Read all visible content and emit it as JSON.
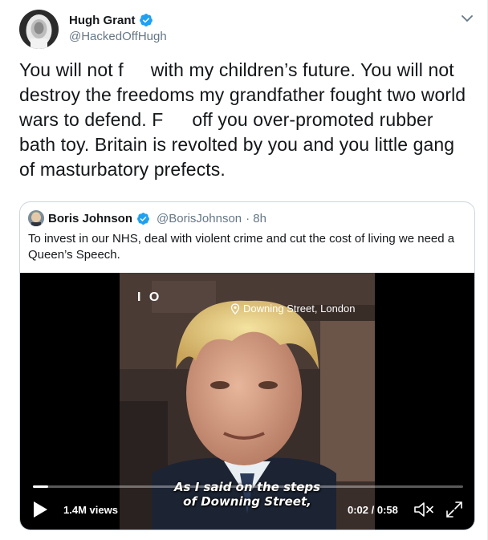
{
  "tweet": {
    "display_name": "Hugh Grant",
    "handle": "@HackedOffHugh",
    "text_line1_a": "You will not f",
    "text_line1_b": "with my children’s future. You will not",
    "text_line2": "destroy the freedoms my grandfather fought two world",
    "text_line3_a": "wars to defend. F",
    "text_line3_b": "off you over-promoted rubber",
    "text_line4": "bath toy. Britain is revolted by you and you little gang",
    "text_line5": "of masturbatory prefects.",
    "verified_color": "#1da1f2"
  },
  "quote": {
    "display_name": "Boris Johnson",
    "handle": "@BorisJohnson",
    "time": "· 8h",
    "text": "To invest in our NHS, deal with violent crime and cut the cost of living we need a Queen’s Speech.",
    "video": {
      "badge": "I O",
      "location": "Downing Street, London",
      "subtitle_line1": "As I said on the steps",
      "subtitle_line2": "of Downing Street,",
      "views": "1.4M views",
      "time": "0:02 / 0:58",
      "progress": 0.035
    }
  },
  "icons": {
    "caret": "chevron-down-icon",
    "verified": "verified-badge-icon",
    "play": "play-icon",
    "mute": "volume-muted-icon",
    "fullscreen": "fullscreen-icon",
    "pin": "location-pin-icon"
  }
}
